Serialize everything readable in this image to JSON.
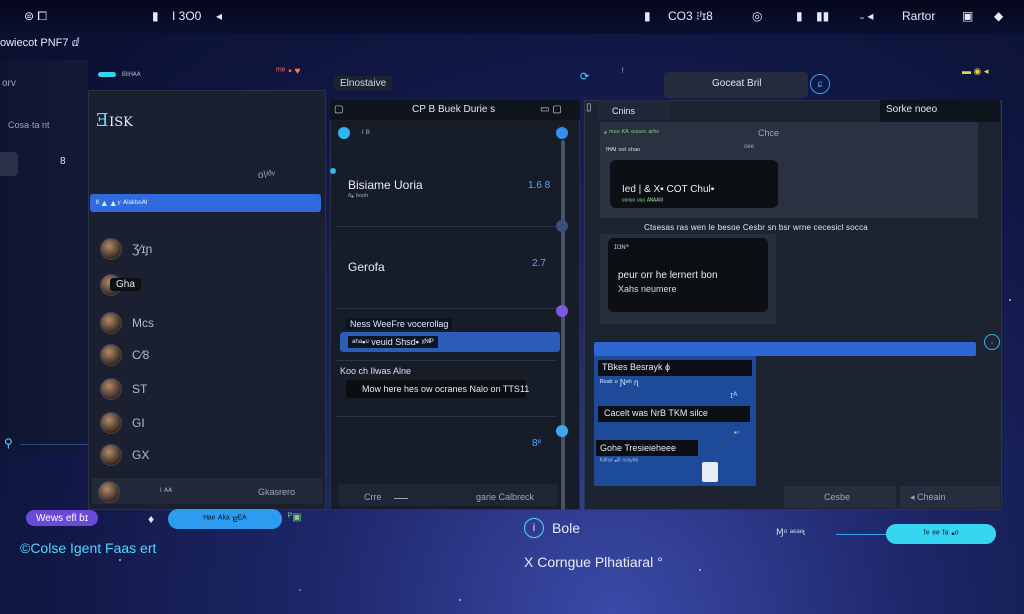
{
  "topbar": {
    "left_icons": "⊜ ⧠",
    "battery_label": "I 3O0",
    "center_right": "CO3 ⁝ᴵɪ8",
    "right_label": "Rartor"
  },
  "window_title": "owiecot PNF7 ⅆ",
  "left_strip": {
    "label1": "orv",
    "label2": "Cosa·ta nt",
    "label3": "8"
  },
  "contacts_panel": {
    "logo_text": "ISK",
    "search_hint": "o\\ᴵᶞᵛ",
    "active_item": "ᴷ▲▲ʸ ᴬᴵᵃᵏᵇᵉᴬᴵ",
    "items": [
      {
        "name": "Ʒ⁄ɪɲ"
      },
      {
        "name": "Gha"
      },
      {
        "name": "Mcs"
      },
      {
        "name": "C⁄8"
      },
      {
        "name": "ST"
      },
      {
        "name": "GI"
      },
      {
        "name": "GX"
      }
    ],
    "bottom_mid": "ᴵ ᴬᴬ",
    "bottom_right": "Gkasrero"
  },
  "chat_panel": {
    "header": "CP B Buek Durie s",
    "item1_title": "Bisiame Uoria",
    "item1_sub": "ᶞ▪ ᵇᵒᵒʰ",
    "item1_time": "1.6 8",
    "item2_title": "Gerofa",
    "item2_time": "2.7",
    "reply1": "Ness WeeFre vocerollag",
    "reply2": "ᵃʰᵃ▪ᵘ veuid Shsd▪ ᵡᴺᴵᴾ",
    "section_label": "Koo ch Ilwas Alne",
    "quote": "Mow here hes ow ocranes Nalo on TTS11",
    "input_left": "Crre",
    "input_right": "garie Calbreck",
    "top_label": "Elnostaive"
  },
  "right_panel": {
    "top_label": "Goceat Bril",
    "header": "Sorke noeo",
    "tab": "Cnins",
    "msg1_sub": "ᶠᴴᴬᴵ ᵒᵒᴵ ᵉʰᵃᵒ",
    "msg1_right": "Chce",
    "msg1": "Ied  |  & X▪ COT Chul▪",
    "msg1_meta": "ᵉᵒᵒᵉᵒ ᵉᵉᵃ ᴬᴺᴬᴬᴵᴵᴵ",
    "divider": "Ctsesas ras wen le besoe Cesbr sn bsr wrne cecesicl socca",
    "msg2_name": "ɪɑɴᵃ",
    "msg2_l1": "peur or‌r he lernert bon",
    "msg2_l2": "Xahs neumere",
    "sub_header": "TBkes Besrayk ɸ",
    "sub_line1": "ᴿᵉᵃᵇ ᵉ Ɲᵃʰ ɳ",
    "sub_line2": "Cacelt was NrB TKM silce",
    "sub_meta": "ɪᴬ",
    "card_title": "Gohe Tresieieheee",
    "card_sub": "ᴷᴬʰᵉᴵ ▪ᴵᴵᴵ ᵒᵒᵃʸᴬᵇ",
    "btn1": "Cesbe",
    "btn2": "Cheain"
  },
  "bottom": {
    "left_pill": "Wews efl ɓɪ",
    "send_pill": "ᴴᵃᵉ ᴬᵏᵃ ɐᴱᴬ",
    "caption": "©Colse Igent Faas ert",
    "mid_icon_label": "Bole",
    "mid_caption": "X Corngue Plhatiaral °",
    "mid_right_label": "Ɱᵒ ᵃᵉᵃᵉɩ",
    "right_pill": "ᶠᵉ ᵉᵉ ᶠᵃ ▪ᵒ"
  },
  "colors": {
    "accent_blue": "#2d6fe0",
    "cyan": "#36d6f2",
    "purple": "#6a4bd8",
    "panel": "#1b2230"
  }
}
